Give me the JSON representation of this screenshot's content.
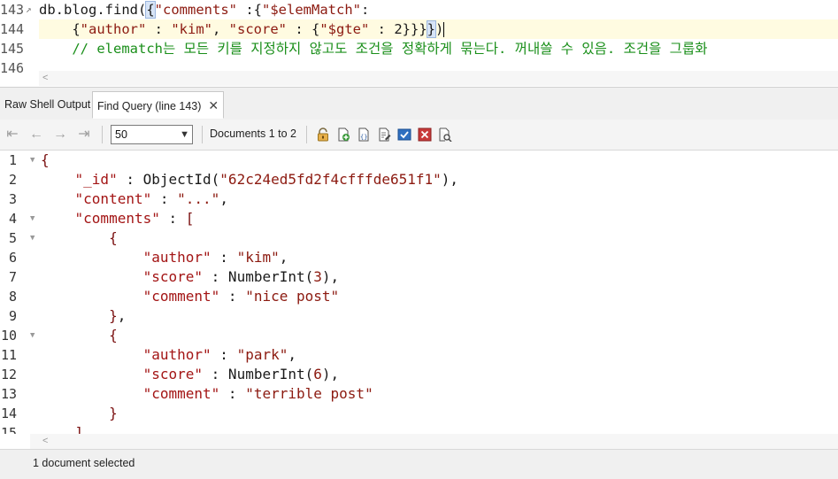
{
  "editor": {
    "lines": [
      {
        "num": "143",
        "parts": [
          {
            "t": "db.blog.find(",
            "c": "k-plain"
          },
          {
            "t": "{",
            "c": "k-plain brkt-hi"
          },
          {
            "t": "\"comments\"",
            "c": "k-str"
          },
          {
            "t": " :{",
            "c": "k-plain"
          },
          {
            "t": "\"$elemMatch\"",
            "c": "k-str"
          },
          {
            "t": ":",
            "c": "k-plain"
          }
        ]
      },
      {
        "num": "144",
        "current": true,
        "parts": [
          {
            "t": "    {",
            "c": "k-plain"
          },
          {
            "t": "\"author\"",
            "c": "k-str"
          },
          {
            "t": " : ",
            "c": "k-plain"
          },
          {
            "t": "\"kim\"",
            "c": "k-str"
          },
          {
            "t": ", ",
            "c": "k-plain"
          },
          {
            "t": "\"score\"",
            "c": "k-str"
          },
          {
            "t": " : {",
            "c": "k-plain"
          },
          {
            "t": "\"$gte\"",
            "c": "k-str"
          },
          {
            "t": " : 2}}}",
            "c": "k-plain"
          },
          {
            "t": "}",
            "c": "k-plain brkt-hi"
          },
          {
            "t": ")",
            "c": "k-plain"
          }
        ]
      },
      {
        "num": "145",
        "parts": [
          {
            "t": "    // elematch는 모든 키를 지정하지 않고도 조건을 정확하게 묶는다. 꺼내쓸 수 있음. 조건을 그룹화",
            "c": "k-com"
          }
        ]
      },
      {
        "num": "146",
        "parts": []
      }
    ]
  },
  "tabs": [
    {
      "label": "Raw Shell Output",
      "active": false
    },
    {
      "label": "Find Query (line 143)",
      "active": true,
      "close": "✕"
    }
  ],
  "toolbar": {
    "page_size": "50",
    "doc_range": "Documents 1 to 2",
    "nav": [
      "first-page",
      "previous-page",
      "next-page",
      "last-page"
    ]
  },
  "result": {
    "lines": [
      {
        "num": "1",
        "fold": true,
        "parts": [
          {
            "t": "{",
            "c": "j-brace"
          }
        ]
      },
      {
        "num": "2",
        "parts": [
          {
            "t": "    ",
            "c": "j-plain"
          },
          {
            "t": "\"_id\"",
            "c": "j-key"
          },
          {
            "t": " : ObjectId(",
            "c": "j-plain"
          },
          {
            "t": "\"62c24ed5fd2f4cfffde651f1\"",
            "c": "j-str"
          },
          {
            "t": "),",
            "c": "j-plain"
          }
        ]
      },
      {
        "num": "3",
        "parts": [
          {
            "t": "    ",
            "c": "j-plain"
          },
          {
            "t": "\"content\"",
            "c": "j-key"
          },
          {
            "t": " : ",
            "c": "j-plain"
          },
          {
            "t": "\"...\"",
            "c": "j-str"
          },
          {
            "t": ",",
            "c": "j-plain"
          }
        ]
      },
      {
        "num": "4",
        "fold": true,
        "parts": [
          {
            "t": "    ",
            "c": "j-plain"
          },
          {
            "t": "\"comments\"",
            "c": "j-key"
          },
          {
            "t": " : ",
            "c": "j-plain"
          },
          {
            "t": "[",
            "c": "j-brace"
          }
        ]
      },
      {
        "num": "5",
        "fold": true,
        "parts": [
          {
            "t": "        ",
            "c": "j-plain"
          },
          {
            "t": "{",
            "c": "j-brace"
          }
        ]
      },
      {
        "num": "6",
        "parts": [
          {
            "t": "            ",
            "c": "j-plain"
          },
          {
            "t": "\"author\"",
            "c": "j-key"
          },
          {
            "t": " : ",
            "c": "j-plain"
          },
          {
            "t": "\"kim\"",
            "c": "j-str"
          },
          {
            "t": ",",
            "c": "j-plain"
          }
        ]
      },
      {
        "num": "7",
        "parts": [
          {
            "t": "            ",
            "c": "j-plain"
          },
          {
            "t": "\"score\"",
            "c": "j-key"
          },
          {
            "t": " : NumberInt(",
            "c": "j-plain"
          },
          {
            "t": "3",
            "c": "j-num"
          },
          {
            "t": "),",
            "c": "j-plain"
          }
        ]
      },
      {
        "num": "8",
        "parts": [
          {
            "t": "            ",
            "c": "j-plain"
          },
          {
            "t": "\"comment\"",
            "c": "j-key"
          },
          {
            "t": " : ",
            "c": "j-plain"
          },
          {
            "t": "\"nice post\"",
            "c": "j-str"
          }
        ]
      },
      {
        "num": "9",
        "parts": [
          {
            "t": "        ",
            "c": "j-plain"
          },
          {
            "t": "}",
            "c": "j-brace"
          },
          {
            "t": ",",
            "c": "j-plain"
          }
        ]
      },
      {
        "num": "10",
        "fold": true,
        "parts": [
          {
            "t": "        ",
            "c": "j-plain"
          },
          {
            "t": "{",
            "c": "j-brace"
          }
        ]
      },
      {
        "num": "11",
        "parts": [
          {
            "t": "            ",
            "c": "j-plain"
          },
          {
            "t": "\"author\"",
            "c": "j-key"
          },
          {
            "t": " : ",
            "c": "j-plain"
          },
          {
            "t": "\"park\"",
            "c": "j-str"
          },
          {
            "t": ",",
            "c": "j-plain"
          }
        ]
      },
      {
        "num": "12",
        "parts": [
          {
            "t": "            ",
            "c": "j-plain"
          },
          {
            "t": "\"score\"",
            "c": "j-key"
          },
          {
            "t": " : NumberInt(",
            "c": "j-plain"
          },
          {
            "t": "6",
            "c": "j-num"
          },
          {
            "t": "),",
            "c": "j-plain"
          }
        ]
      },
      {
        "num": "13",
        "parts": [
          {
            "t": "            ",
            "c": "j-plain"
          },
          {
            "t": "\"comment\"",
            "c": "j-key"
          },
          {
            "t": " : ",
            "c": "j-plain"
          },
          {
            "t": "\"terrible post\"",
            "c": "j-str"
          }
        ]
      },
      {
        "num": "14",
        "parts": [
          {
            "t": "        ",
            "c": "j-plain"
          },
          {
            "t": "}",
            "c": "j-brace"
          }
        ]
      },
      {
        "num": "15",
        "parts": [
          {
            "t": "    ",
            "c": "j-plain"
          },
          {
            "t": "]",
            "c": "j-brace"
          }
        ]
      }
    ]
  },
  "status": {
    "text": "1 document selected"
  },
  "icons": [
    "lock-icon",
    "add-document-icon",
    "edit-json-icon",
    "edit-document-icon",
    "select-all-icon",
    "delete-icon",
    "query-icon"
  ]
}
